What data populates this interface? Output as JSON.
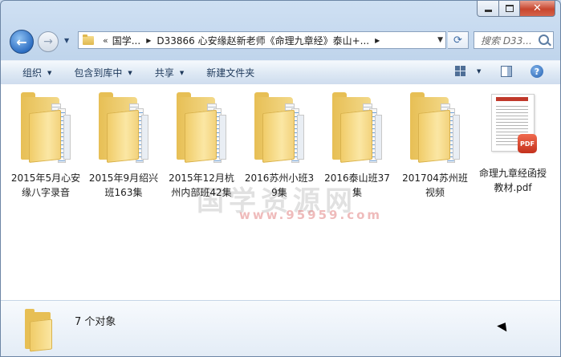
{
  "address": {
    "overflow": "«",
    "segments": [
      "国学...",
      "D33866 心安缘赵新老师《命理九章经》泰山+..."
    ]
  },
  "search": {
    "placeholder": "搜索 D33..."
  },
  "toolbar": {
    "organize": "组织",
    "include_in_library": "包含到库中",
    "share": "共享",
    "new_folder": "新建文件夹"
  },
  "items": [
    {
      "name": "2015年5月心安缘八字录音",
      "type": "folder"
    },
    {
      "name": "2015年9月绍兴班163集",
      "type": "folder"
    },
    {
      "name": "2015年12月杭州内部班42集",
      "type": "folder"
    },
    {
      "name": "2016苏州小班39集",
      "type": "folder"
    },
    {
      "name": "2016泰山班37集",
      "type": "folder"
    },
    {
      "name": "201704苏州班视频",
      "type": "folder"
    },
    {
      "name": "命理九章经函授教材.pdf",
      "type": "pdf"
    }
  ],
  "pdf_badge": "PDF",
  "watermark": {
    "main": "国学资源网",
    "sub": "www.95959.com"
  },
  "details": {
    "count_text": "7 个对象"
  },
  "icons": {
    "back": "back-arrow-icon",
    "forward": "forward-arrow-icon",
    "refresh": "refresh-icon",
    "search": "search-icon",
    "views": "views-icon",
    "preview_pane": "preview-pane-icon",
    "help": "help-icon"
  },
  "colors": {
    "window_frame": "#bcd2ea",
    "toolbar_text": "#1e395b",
    "close_button": "#c8462e",
    "folder": "#f0cb66"
  }
}
